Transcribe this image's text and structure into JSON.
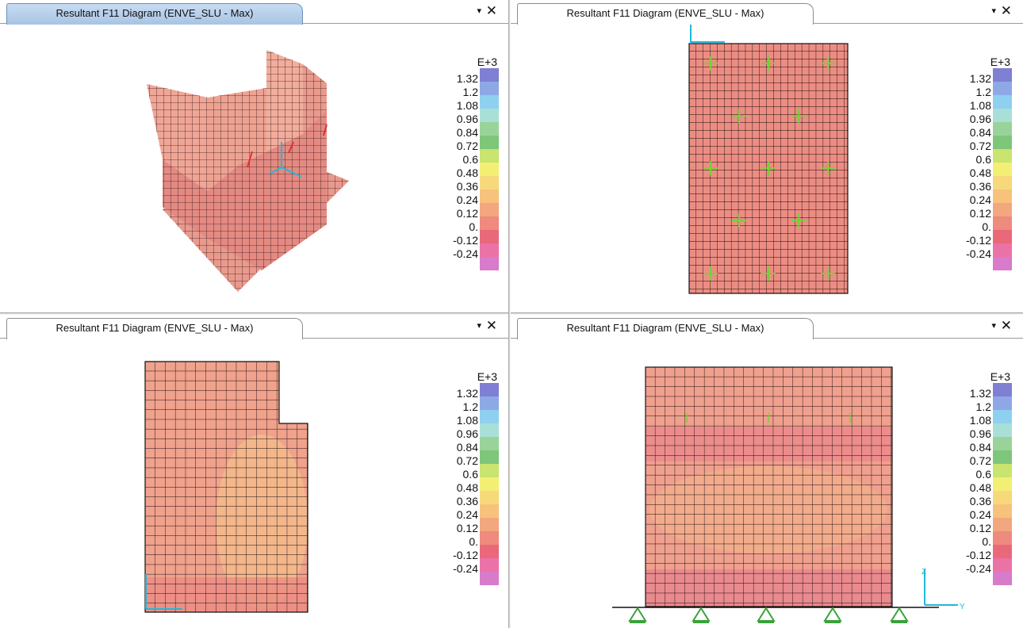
{
  "panes": [
    {
      "id": "top-left",
      "tab_title": "Resultant F11 Diagram (ENVE_SLU - Max)",
      "active": true
    },
    {
      "id": "top-right",
      "tab_title": "Resultant F11 Diagram (ENVE_SLU - Max)",
      "active": false
    },
    {
      "id": "bottom-left",
      "tab_title": "Resultant F11 Diagram (ENVE_SLU - Max)",
      "active": false
    },
    {
      "id": "bottom-right",
      "tab_title": "Resultant F11 Diagram (ENVE_SLU - Max)",
      "active": false
    }
  ],
  "controls": {
    "dropdown_icon": "▾",
    "close_icon": "✕"
  },
  "legend": {
    "exponent": "E+3",
    "labels": [
      "1.32",
      "1.2",
      "1.08",
      "0.96",
      "0.84",
      "0.72",
      "0.6",
      "0.48",
      "0.36",
      "0.24",
      "0.12",
      "0.",
      "-0.12",
      "-0.24"
    ],
    "colors": [
      "#7f7fd3",
      "#8ea8e6",
      "#8fd0f0",
      "#a8e0d8",
      "#9ad39a",
      "#7ec67a",
      "#c9e46f",
      "#f3ef74",
      "#f7d97b",
      "#f7c27c",
      "#f2a77e",
      "#ee8a7e",
      "#e9697b",
      "#eb72a6",
      "#d87bcb"
    ]
  },
  "axis_labels": {
    "z": "Z",
    "y": "Y"
  }
}
